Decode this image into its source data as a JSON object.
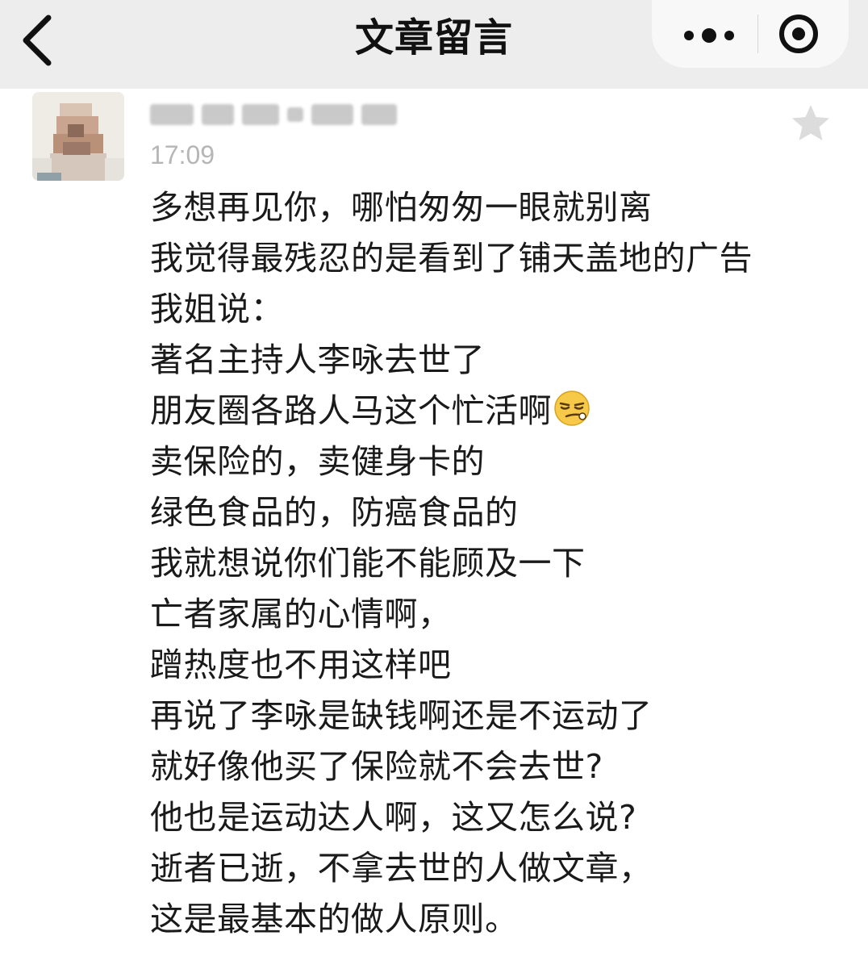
{
  "nav": {
    "title": "文章留言",
    "back_icon": "chevron-left-icon",
    "more_icon": "more-dots-icon",
    "close_icon": "target-close-icon",
    "background": "#ededed"
  },
  "comment": {
    "time": "17:09",
    "star_icon": "star-icon",
    "emoji_icon": "smirk-face-emoji",
    "lines": [
      "多想再见你，哪怕匆匆一眼就别离",
      "我觉得最残忍的是看到了铺天盖地的广告",
      "我姐说：",
      "著名主持人李咏去世了",
      "朋友圈各路人马这个忙活啊",
      "卖保险的，卖健身卡的",
      "绿色食品的，防癌食品的",
      "我就想说你们能不能顾及一下",
      "亡者家属的心情啊，",
      "蹭热度也不用这样吧",
      "再说了李咏是缺钱啊还是不运动了",
      "就好像他买了保险就不会去世?",
      "他也是运动达人啊，这又怎么说?",
      "逝者已逝，不拿去世的人做文章，",
      "这是最基本的做人原则。"
    ]
  }
}
